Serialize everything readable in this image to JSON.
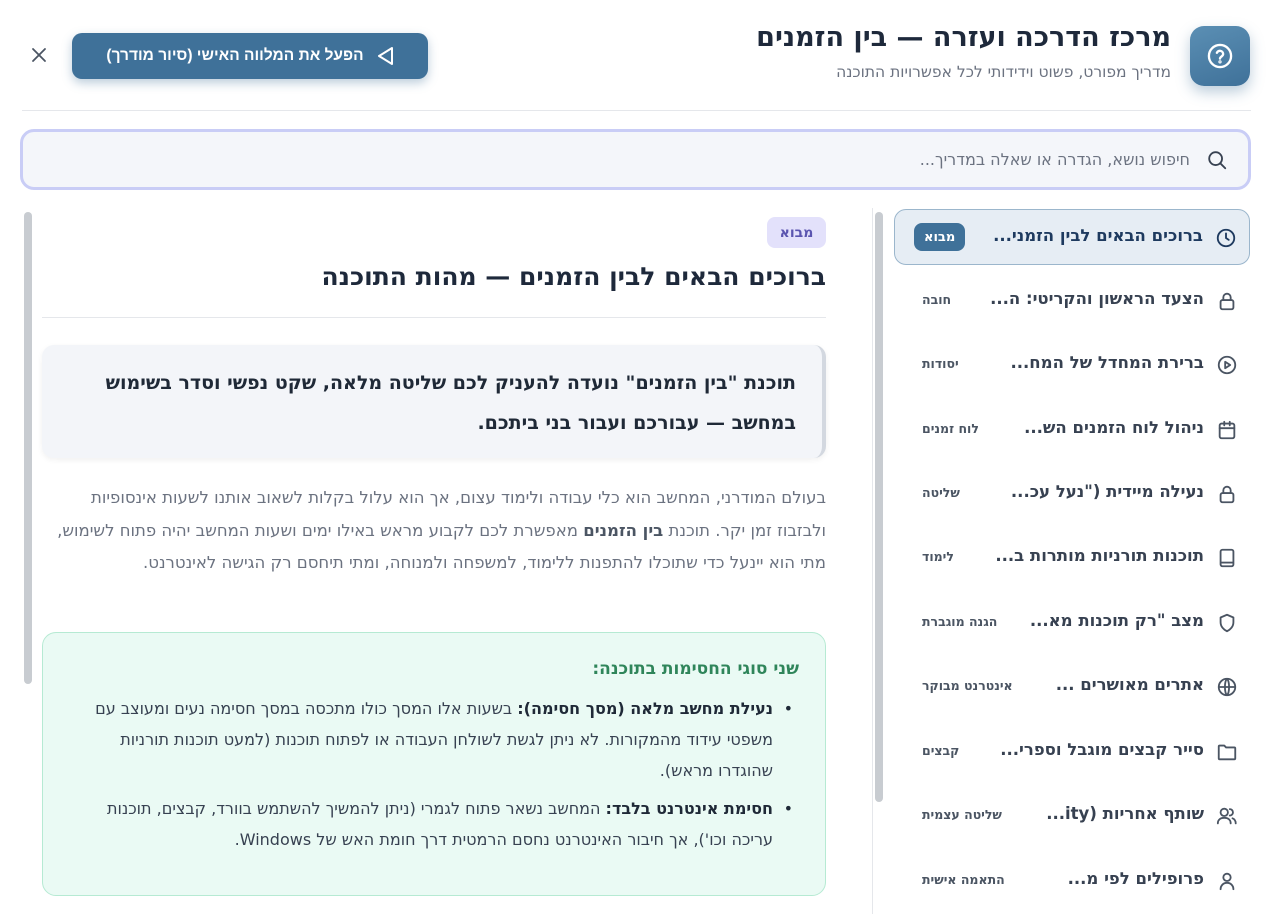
{
  "header": {
    "title": "מרכז הדרכה ועזרה — בין הזמנים",
    "subtitle": "מדריך מפורט, פשוט וידידותי לכל אפשרויות התוכנה",
    "tour_button_label": "הפעל את המלווה האישי (סיור מודרך)",
    "help_icon": "help-circle-icon",
    "close_icon": "close-icon"
  },
  "search": {
    "placeholder": "חיפוש נושא, הגדרה או שאלה במדריך..."
  },
  "sidebar": {
    "items": [
      {
        "label": "ברוכים הבאים לבין הזמני...",
        "tag": "מבוא",
        "icon": "clock-icon",
        "active": true
      },
      {
        "label": "הצעד הראשון והקריטי: ה...",
        "tag": "חובה",
        "icon": "lock-icon"
      },
      {
        "label": "ברירת המחדל של המח...",
        "tag": "יסודות",
        "icon": "play-circle-icon"
      },
      {
        "label": "ניהול לוח הזמנים הש...",
        "tag": "לוח זמנים",
        "icon": "calendar-icon"
      },
      {
        "label": "נעילה מיידית (\"נעל עכ...",
        "tag": "שליטה",
        "icon": "lock-icon"
      },
      {
        "label": "תוכנות תורניות מותרות ב...",
        "tag": "לימוד",
        "icon": "book-icon"
      },
      {
        "label": "מצב \"רק תוכנות מא...",
        "tag": "הגנה מוגברת",
        "icon": "shield-icon"
      },
      {
        "label": "אתרים מאושרים ...",
        "tag": "אינטרנט מבוקר",
        "icon": "globe-icon"
      },
      {
        "label": "סייר קבצים מוגבל וספרי...",
        "tag": "קבצים",
        "icon": "folder-icon"
      },
      {
        "label": "שותף אחריות (ity...",
        "tag": "שליטה עצמית",
        "icon": "users-icon"
      },
      {
        "label": "פרופילים לפי מ...",
        "tag": "התאמה אישית",
        "icon": "user-icon"
      }
    ]
  },
  "content": {
    "chip": "מבוא",
    "title": "ברוכים הבאים לבין הזמנים — מהות התוכנה",
    "lead_prefix": "תוכנת \"",
    "lead_name": "בין הזמנים",
    "lead_suffix": "\" נועדה להעניק לכם שליטה מלאה, שקט נפשי וסדר בשימוש במחשב — עבורכם ועבור בני ביתכם.",
    "body_part1": "בעולם המודרני, המחשב הוא כלי עבודה ולימוד עצום, אך הוא עלול בקלות לשאוב אותנו לשעות אינסופיות ולבזבוז זמן יקר. תוכנת ",
    "body_name": "בין הזמנים",
    "body_part2": " מאפשרת לכם לקבוע מראש באילו ימים ושעות המחשב יהיה פתוח לשימוש, מתי הוא יינעל כדי שתוכלו להתפנות ללימוד, למשפחה ולמנוחה, ומתי תיחסם רק הגישה לאינטרנט.",
    "box_title": "שני סוגי החסימות בתוכנה:",
    "bullets": [
      {
        "bold": "נעילת מחשב מלאה (מסך חסימה):",
        "text": " בשעות אלו המסך כולו מתכסה במסך חסימה נעים ומעוצב עם משפטי עידוד מהמקורות. לא ניתן לגשת לשולחן העבודה או לפתוח תוכנות (למעט תוכנות תורניות שהוגדרו מראש)."
      },
      {
        "bold": "חסימת אינטרנט בלבד:",
        "text": " המחשב נשאר פתוח לגמרי (ניתן להמשיך להשתמש בוורד, קבצים, תוכנות עריכה וכו'), אך חיבור האינטרנט נחסם הרמטית דרך חומת האש של Windows."
      }
    ]
  },
  "colors": {
    "accent": "#3f7199",
    "active_bg": "#e6edf4",
    "chip_bg": "#e3e1fb",
    "green_bg": "#eafaf4",
    "green_title": "#2f855a"
  }
}
